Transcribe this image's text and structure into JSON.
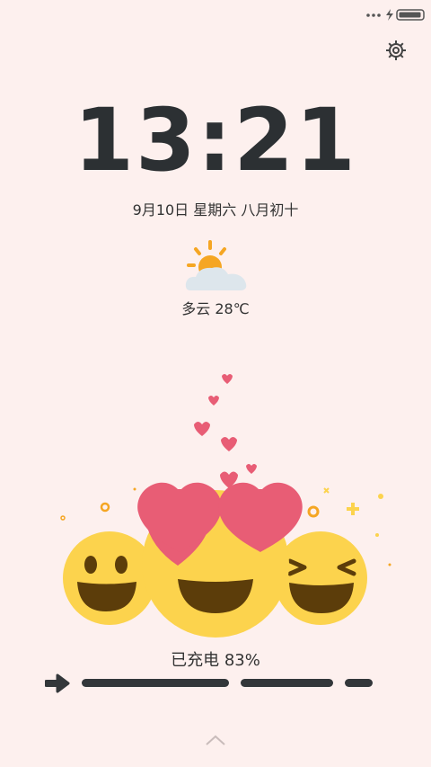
{
  "status_bar": {
    "icons": [
      "more-dots-icon",
      "charging-bolt-icon",
      "battery-icon"
    ]
  },
  "settings": {
    "icon": "gear-icon"
  },
  "clock": {
    "time": "13:21"
  },
  "date": {
    "text": "9月10日 星期六 八月初十"
  },
  "weather": {
    "icon": "partly-cloudy-icon",
    "text": "多云 28℃"
  },
  "charging": {
    "text": "已充电  83%",
    "level_percent": 83
  },
  "bottom": {
    "icon": "chevron-up-icon"
  },
  "colors": {
    "background": "#fdf0ee",
    "dark": "#2c3033",
    "heart": "#e85d75",
    "emoji": "#fcd34d"
  }
}
